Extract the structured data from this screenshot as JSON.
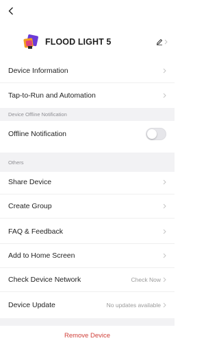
{
  "header": {
    "device_name": "FLOOD LIGHT 5",
    "icon": "flood-light-device-icon"
  },
  "rows": {
    "device_information": "Device Information",
    "tap_to_run": "Tap-to-Run and Automation",
    "offline_notification": "Offline Notification",
    "share_device": "Share Device",
    "create_group": "Create Group",
    "faq": "FAQ & Feedback",
    "add_home": "Add to Home Screen",
    "check_network": "Check Device Network",
    "check_network_value": "Check Now",
    "device_update": "Device Update",
    "device_update_value": "No updates available"
  },
  "sections": {
    "offline": "Device Offline Notification",
    "others": "Others"
  },
  "toggles": {
    "offline_notification_on": false
  },
  "footer": {
    "remove_label": "Remove Device"
  },
  "colors": {
    "remove_text": "#d0403a",
    "section_bg": "#f2f2f4",
    "secondary_text": "#9a9a9a"
  }
}
